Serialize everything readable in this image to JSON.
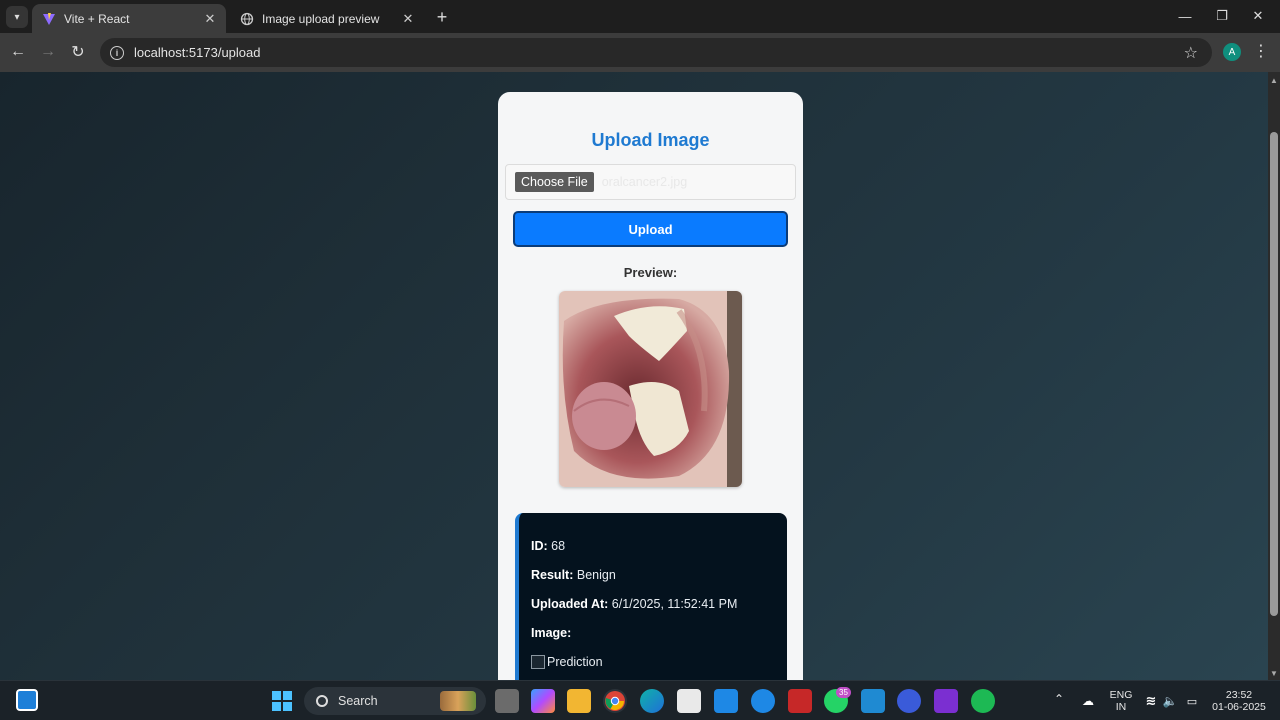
{
  "browser": {
    "tabs": [
      {
        "title": "Vite + React",
        "active": true,
        "icon": "vite-icon"
      },
      {
        "title": "Image upload preview",
        "active": false,
        "icon": "globe-icon"
      }
    ],
    "url": "localhost:5173/upload",
    "profile_initial": "A"
  },
  "page": {
    "heading": "Upload Image",
    "file_input": {
      "button_label": "Choose File",
      "file_name": "oralcancer2.jpg"
    },
    "upload_button": "Upload",
    "preview_label": "Preview:",
    "result": {
      "id_label": "ID:",
      "id_value": "68",
      "result_label": "Result:",
      "result_value": "Benign",
      "uploaded_label": "Uploaded At:",
      "uploaded_value": "6/1/2025, 11:52:41 PM",
      "image_label": "Image:",
      "image_alt": "Prediction"
    }
  },
  "taskbar": {
    "search_placeholder": "Search",
    "whatsapp_badge": "35",
    "language_line1": "ENG",
    "language_line2": "IN",
    "time": "23:52",
    "date": "01-06-2025"
  },
  "colors": {
    "accent": "#1f7ad1",
    "upload_button": "#0a7bff",
    "result_card": "#04121e"
  }
}
